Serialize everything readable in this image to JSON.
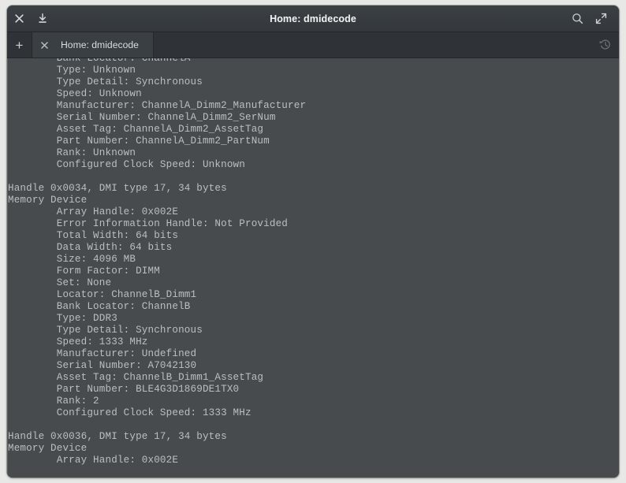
{
  "window": {
    "title": "Home: dmidecode",
    "titlebar_buttons": [
      {
        "name": "close-icon",
        "label": "×"
      },
      {
        "name": "download-icon",
        "label": "⤓"
      }
    ],
    "titlebar_right_buttons": [
      {
        "name": "search-icon",
        "label": "search"
      },
      {
        "name": "expand-icon",
        "label": "expand"
      }
    ]
  },
  "tabbar": {
    "new_tab_label": "+",
    "tab_close_label": "×",
    "history_label": "history",
    "tabs": [
      {
        "title": "Home: dmidecode",
        "active": true
      }
    ]
  },
  "terminal": {
    "colors": {
      "background": "#474b4e",
      "foreground": "#b9bfc3"
    },
    "lines": [
      "        Bank Locator: ChannelA",
      "        Type: Unknown",
      "        Type Detail: Synchronous",
      "        Speed: Unknown",
      "        Manufacturer: ChannelA_Dimm2_Manufacturer",
      "        Serial Number: ChannelA_Dimm2_SerNum",
      "        Asset Tag: ChannelA_Dimm2_AssetTag",
      "        Part Number: ChannelA_Dimm2_PartNum",
      "        Rank: Unknown",
      "        Configured Clock Speed: Unknown",
      "",
      "Handle 0x0034, DMI type 17, 34 bytes",
      "Memory Device",
      "        Array Handle: 0x002E",
      "        Error Information Handle: Not Provided",
      "        Total Width: 64 bits",
      "        Data Width: 64 bits",
      "        Size: 4096 MB",
      "        Form Factor: DIMM",
      "        Set: None",
      "        Locator: ChannelB_Dimm1",
      "        Bank Locator: ChannelB",
      "        Type: DDR3",
      "        Type Detail: Synchronous",
      "        Speed: 1333 MHz",
      "        Manufacturer: Undefined",
      "        Serial Number: A7042130",
      "        Asset Tag: ChannelB_Dimm1_AssetTag",
      "        Part Number: BLE4G3D1869DE1TX0",
      "        Rank: 2",
      "        Configured Clock Speed: 1333 MHz",
      "",
      "Handle 0x0036, DMI type 17, 34 bytes",
      "Memory Device",
      "        Array Handle: 0x002E"
    ]
  }
}
